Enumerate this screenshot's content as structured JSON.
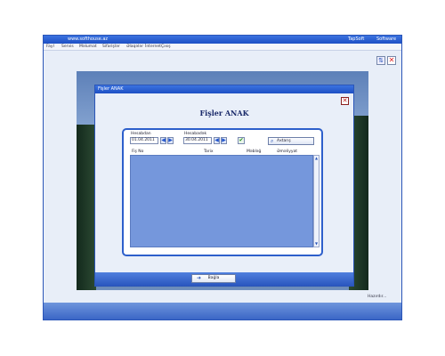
{
  "window": {
    "title": "www.softhouse.az",
    "title_right": [
      "TapSoft",
      "Software"
    ]
  },
  "menu": {
    "items": [
      "Fayl",
      "Servis",
      "Məlumat",
      "Sifarişlər",
      "Əlaqələr",
      "İnternet",
      "Çıxış"
    ]
  },
  "toolbar": {
    "restore_icon": "restore-icon",
    "close_icon": "close-icon"
  },
  "dialog": {
    "title": "Fişler ANAK",
    "heading": "Fişler ANAK",
    "start_label": "Hesabdan",
    "start_value": "01.04.2011",
    "end_label": "Hesabadək",
    "end_value": "30.04.2011",
    "search_label": "Axtarış",
    "columns": [
      "Fiş No",
      "Tarix",
      "Məbləğ",
      "Əməliyyat"
    ],
    "close_label": "Bağla"
  },
  "status": {
    "text": "Hazırdır..."
  },
  "colors": {
    "accent": "#2a55b8",
    "grid_background": "#7597dc",
    "titlebar": "#1d4fc4"
  }
}
